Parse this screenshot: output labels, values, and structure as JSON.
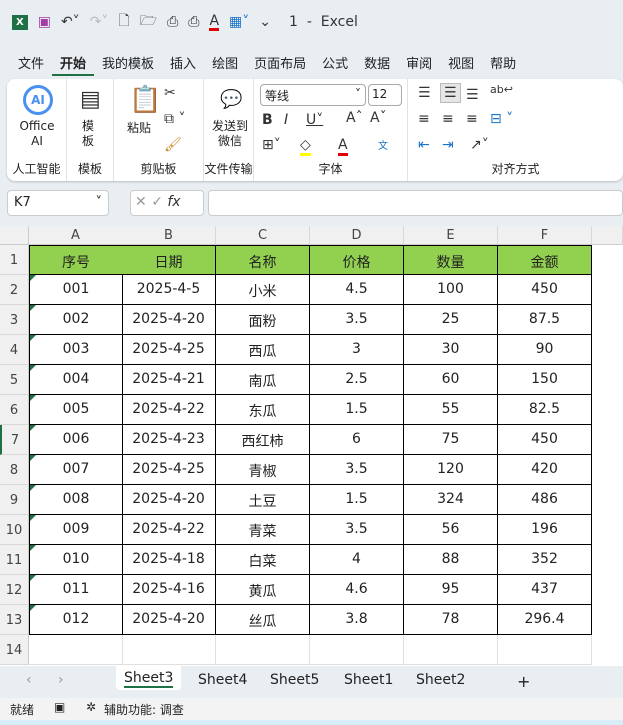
{
  "window": {
    "title": "1  -  Excel"
  },
  "menu": [
    "文件",
    "开始",
    "我的模板",
    "插入",
    "绘图",
    "页面布局",
    "公式",
    "数据",
    "审阅",
    "视图",
    "帮助"
  ],
  "ribbon": {
    "office_ai": "Office AI",
    "ai_group": "人工智能",
    "template": "模板",
    "template_group": "模板",
    "paste": "粘贴",
    "clipboard_group": "剪贴板",
    "send_wechat": "发送到微信",
    "file_transfer_group": "文件传输",
    "font_name": "等线",
    "font_size": "12",
    "font_group": "字体",
    "align_group": "对齐方式",
    "font_color": "#e00000",
    "highlight_color": "#ffff00"
  },
  "formula_bar": {
    "name_box": "K7",
    "fx": "fx",
    "value": ""
  },
  "columns": [
    "A",
    "B",
    "C",
    "D",
    "E",
    "F"
  ],
  "header": [
    "序号",
    "日期",
    "名称",
    "价格",
    "数量",
    "金额"
  ],
  "rows": [
    [
      "001",
      "2025-4-5",
      "小米",
      "4.5",
      "100",
      "450"
    ],
    [
      "002",
      "2025-4-20",
      "面粉",
      "3.5",
      "25",
      "87.5"
    ],
    [
      "003",
      "2025-4-25",
      "西瓜",
      "3",
      "30",
      "90"
    ],
    [
      "004",
      "2025-4-21",
      "南瓜",
      "2.5",
      "60",
      "150"
    ],
    [
      "005",
      "2025-4-22",
      "东瓜",
      "1.5",
      "55",
      "82.5"
    ],
    [
      "006",
      "2025-4-23",
      "西红柿",
      "6",
      "75",
      "450"
    ],
    [
      "007",
      "2025-4-25",
      "青椒",
      "3.5",
      "120",
      "420"
    ],
    [
      "008",
      "2025-4-20",
      "土豆",
      "1.5",
      "324",
      "486"
    ],
    [
      "009",
      "2025-4-22",
      "青菜",
      "3.5",
      "56",
      "196"
    ],
    [
      "010",
      "2025-4-18",
      "白菜",
      "4",
      "88",
      "352"
    ],
    [
      "011",
      "2025-4-16",
      "黄瓜",
      "4.6",
      "95",
      "437"
    ],
    [
      "012",
      "2025-4-20",
      "丝瓜",
      "3.8",
      "78",
      "296.4"
    ]
  ],
  "row_numbers": [
    "1",
    "2",
    "3",
    "4",
    "5",
    "6",
    "7",
    "8",
    "9",
    "10",
    "11",
    "12",
    "13",
    "14"
  ],
  "header_fill": "#92d050",
  "sheets": [
    "Sheet3",
    "Sheet4",
    "Sheet5",
    "Sheet1",
    "Sheet2"
  ],
  "active_sheet": "Sheet3",
  "status": {
    "ready": "就绪",
    "accessibility": "辅助功能: 调查"
  }
}
